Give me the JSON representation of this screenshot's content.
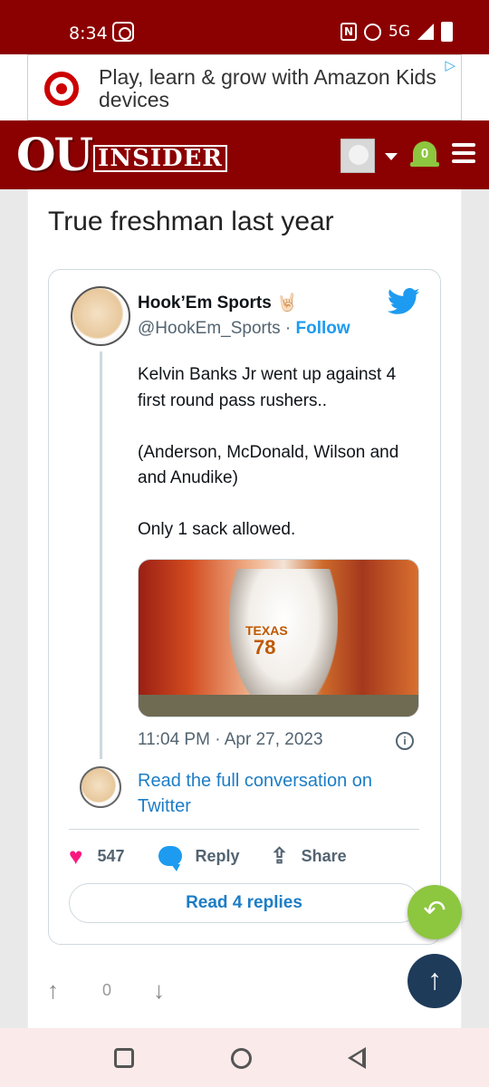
{
  "status_bar": {
    "time": "8:34",
    "network": "5G"
  },
  "ad": {
    "text": "Play, learn & grow with Amazon Kids devices"
  },
  "header": {
    "brand_ou": "OU",
    "brand_insider": "INSIDER",
    "notification_count": "0"
  },
  "post": {
    "text": "True freshman last year"
  },
  "tweet": {
    "author_name": "Hook’Em Sports 🤘🏻",
    "handle": "@HookEm_Sports",
    "separator": " · ",
    "follow_label": "Follow",
    "body": "Kelvin Banks Jr went up against 4 first round pass rushers..\n\n(Anderson, McDonald, Wilson and and Anudike)\n\nOnly 1 sack allowed.",
    "photo_jersey_text": "TEXAS",
    "photo_jersey_number": "78",
    "timestamp": "11:04 PM · Apr 27, 2023",
    "read_full_label": "Read the full conversation on Twitter",
    "like_count": "547",
    "reply_label": "Reply",
    "share_label": "Share",
    "read_replies_label": "Read 4 replies"
  },
  "votes": {
    "count": "0"
  },
  "icons": {
    "accent_green": "#8dc63f",
    "brand_red": "#8b0000",
    "twitter_blue": "#1d9bf0"
  }
}
